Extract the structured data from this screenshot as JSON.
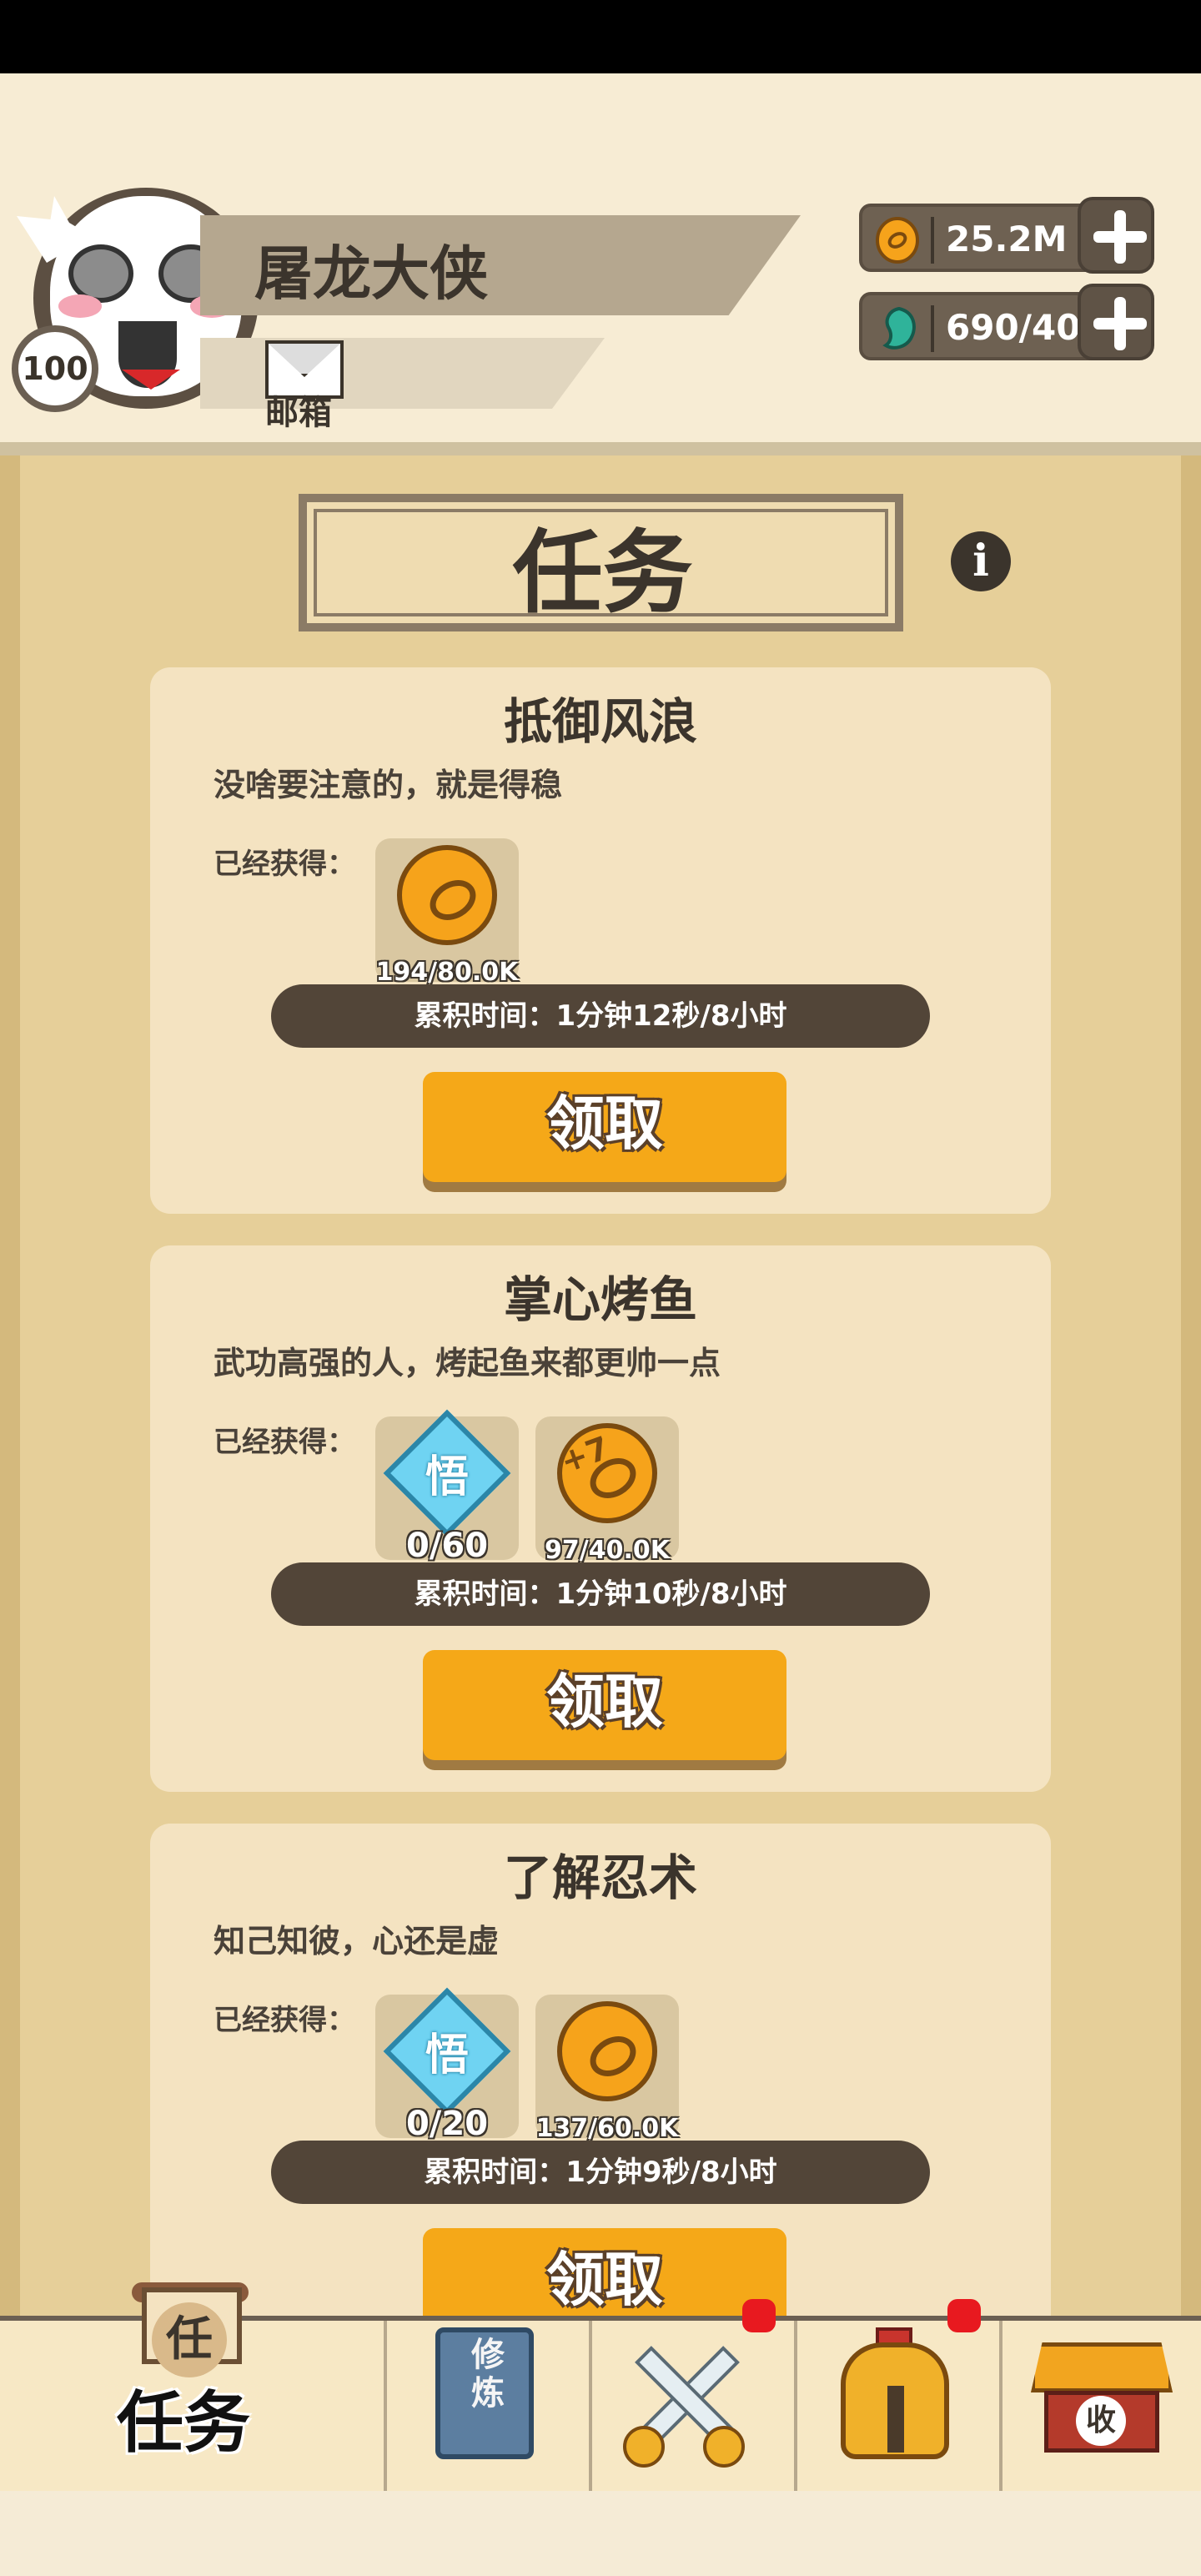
{
  "player": {
    "name": "屠龙大侠",
    "level": "100",
    "mail_label": "邮箱"
  },
  "resources": {
    "coins": "25.2M",
    "gems": "690/40",
    "colors": {
      "coin": "#f6a31b",
      "gem": "#2fb39a"
    }
  },
  "page": {
    "title": "任务",
    "info_icon": "i"
  },
  "tasks": [
    {
      "title": "抵御风浪",
      "description": "没啥要注意的，就是得稳",
      "earned_label": "已经获得：",
      "rewards": [
        {
          "icon": "coin-icon",
          "count": "194/80.0K"
        }
      ],
      "time": "累积时间：1分钟12秒/8小时",
      "claim_label": "领取"
    },
    {
      "title": "掌心烤鱼",
      "description": "武功高强的人，烤起鱼来都更帅一点",
      "earned_label": "已经获得：",
      "rewards": [
        {
          "icon": "enlightenment-gem-icon",
          "char": "悟",
          "count": "0/60"
        },
        {
          "icon": "coin-plus7-icon",
          "char": "+7",
          "count": "97/40.0K"
        }
      ],
      "time": "累积时间：1分钟10秒/8小时",
      "claim_label": "领取"
    },
    {
      "title": "了解忍术",
      "description": "知己知彼，心还是虚",
      "earned_label": "已经获得：",
      "rewards": [
        {
          "icon": "enlightenment-gem-icon",
          "char": "悟",
          "count": "0/20"
        },
        {
          "icon": "coin-icon",
          "count": "137/60.0K"
        }
      ],
      "time": "累积时间：1分钟9秒/8小时",
      "claim_label": "领取"
    }
  ],
  "nav": {
    "tasks_char": "任",
    "tasks_label": "任务",
    "cultivate_text": "修炼",
    "shop_char": "收",
    "badge_color": "#e8191f"
  }
}
